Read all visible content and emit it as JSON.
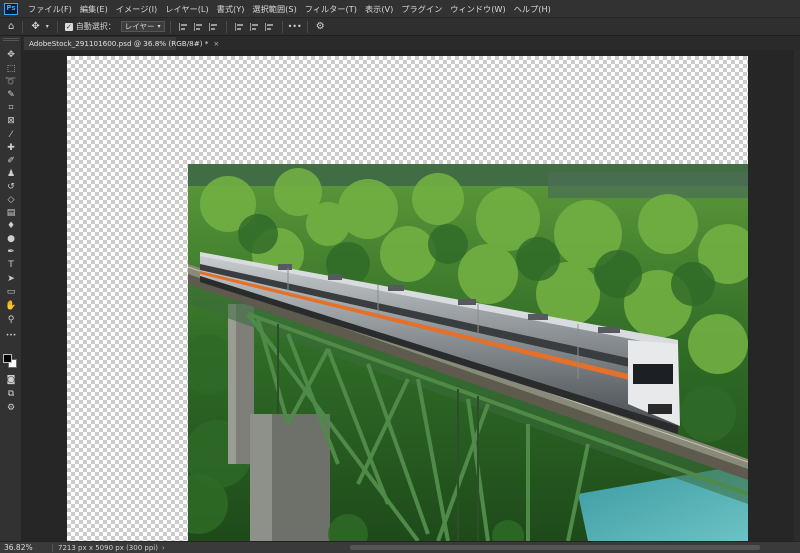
{
  "app": {
    "logo_text": "Ps"
  },
  "menu": {
    "items": [
      "ファイル(F)",
      "編集(E)",
      "イメージ(I)",
      "レイヤー(L)",
      "書式(Y)",
      "選択範囲(S)",
      "フィルター(T)",
      "表示(V)",
      "プラグイン",
      "ウィンドウ(W)",
      "ヘルプ(H)"
    ]
  },
  "options": {
    "auto_select_label": "自動選択：",
    "auto_select_value": "レイヤー",
    "auto_select_checked": true,
    "more_label": "•••"
  },
  "document": {
    "tab_title": "AdobeStock_291101600.psd @ 36.8% (RGB/8#) *",
    "close_glyph": "×"
  },
  "tools": [
    {
      "name": "move-tool",
      "icon": "move-icon",
      "glyph": "✥"
    },
    {
      "name": "marquee-tool",
      "icon": "marquee-icon",
      "glyph": "⬚"
    },
    {
      "name": "lasso-tool",
      "icon": "lasso-icon",
      "glyph": "➰"
    },
    {
      "name": "quick-select-tool",
      "icon": "quick-select-icon",
      "glyph": "✎"
    },
    {
      "name": "crop-tool",
      "icon": "crop-icon",
      "glyph": "⌗"
    },
    {
      "name": "frame-tool",
      "icon": "frame-icon",
      "glyph": "⊠"
    },
    {
      "name": "eyedropper-tool",
      "icon": "eyedropper-icon",
      "glyph": "⁄"
    },
    {
      "name": "healing-brush-tool",
      "icon": "bandage-icon",
      "glyph": "✚"
    },
    {
      "name": "brush-tool",
      "icon": "brush-icon",
      "glyph": "✐"
    },
    {
      "name": "clone-stamp-tool",
      "icon": "stamp-icon",
      "glyph": "♟"
    },
    {
      "name": "history-brush-tool",
      "icon": "history-brush-icon",
      "glyph": "↺"
    },
    {
      "name": "eraser-tool",
      "icon": "eraser-icon",
      "glyph": "◇"
    },
    {
      "name": "gradient-tool",
      "icon": "gradient-icon",
      "glyph": "▤"
    },
    {
      "name": "blur-tool",
      "icon": "droplet-icon",
      "glyph": "♦"
    },
    {
      "name": "dodge-tool",
      "icon": "dodge-icon",
      "glyph": "●"
    },
    {
      "name": "pen-tool",
      "icon": "pen-icon",
      "glyph": "✒"
    },
    {
      "name": "type-tool",
      "icon": "type-icon",
      "glyph": "T"
    },
    {
      "name": "path-select-tool",
      "icon": "arrow-icon",
      "glyph": "➤"
    },
    {
      "name": "shape-tool",
      "icon": "rectangle-icon",
      "glyph": "▭"
    },
    {
      "name": "hand-tool",
      "icon": "hand-icon",
      "glyph": "✋"
    },
    {
      "name": "zoom-tool",
      "icon": "zoom-icon",
      "glyph": "⚲"
    },
    {
      "name": "more-tools",
      "icon": "more-icon",
      "glyph": "•••"
    }
  ],
  "tools_bottom": [
    {
      "name": "quick-mask-button",
      "icon": "quick-mask-icon",
      "glyph": "◙"
    },
    {
      "name": "screen-mode-button",
      "icon": "screen-mode-icon",
      "glyph": "⧉"
    },
    {
      "name": "edit-toolbar-button",
      "icon": "edit-toolbar-icon",
      "glyph": "⚙"
    }
  ],
  "colors": {
    "foreground": "#000000",
    "background": "#ffffff"
  },
  "status": {
    "zoom": "36.82%",
    "doc_info": "7213 px x 5090 px (300 ppi)",
    "arrow": "›"
  }
}
